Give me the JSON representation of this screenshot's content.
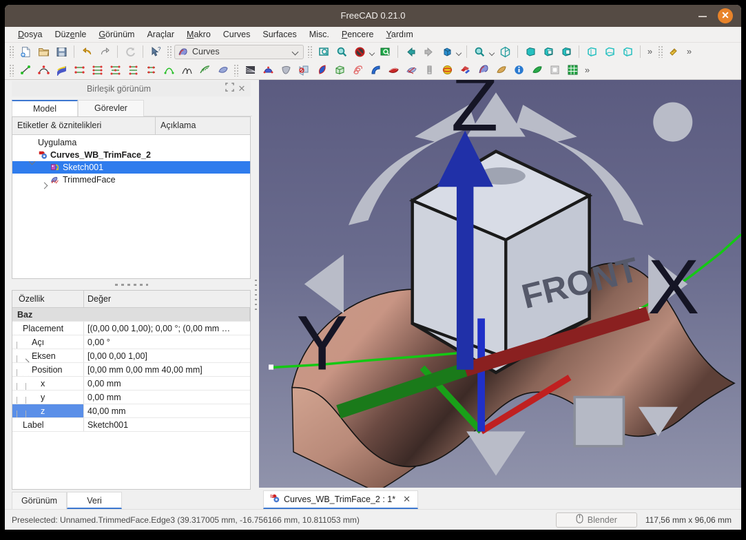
{
  "window": {
    "title": "FreeCAD 0.21.0",
    "minimize_label": "–",
    "close_label": "✕"
  },
  "menubar": {
    "items": [
      {
        "pre": "",
        "mn": "D",
        "post": "osya"
      },
      {
        "pre": "Düz",
        "mn": "e",
        "post": "nle"
      },
      {
        "pre": "",
        "mn": "G",
        "post": "örünüm"
      },
      {
        "pre": "Araçlar",
        "mn": "",
        "post": ""
      },
      {
        "pre": "",
        "mn": "M",
        "post": "akro"
      },
      {
        "pre": "Curves",
        "mn": "",
        "post": ""
      },
      {
        "pre": "Surfaces",
        "mn": "",
        "post": ""
      },
      {
        "pre": "Misc.",
        "mn": "",
        "post": ""
      },
      {
        "pre": "",
        "mn": "P",
        "post": "encere"
      },
      {
        "pre": "",
        "mn": "Y",
        "post": "ardım"
      }
    ]
  },
  "toolbar": {
    "workbench_label": "Curves",
    "overflow_label": "»",
    "row1_icons": [
      "new-document-icon",
      "open-document-icon",
      "save-document-icon",
      "undo-icon",
      "redo-icon",
      "refresh-icon",
      "whats-this-icon"
    ],
    "row1_view_icons": [
      "fit-all-icon",
      "zoom-box-icon",
      "draw-style-icon",
      "fit-selection-icon",
      "back-view-icon",
      "forward-view-icon",
      "axonometric-icon",
      "zoom-icon",
      "isometric-icon",
      "front-view-icon",
      "top-view-icon",
      "right-view-icon",
      "rear-view-icon",
      "bottom-view-icon",
      "left-view-icon",
      "measure-icon"
    ],
    "row2_curve_icons": [
      "line-icon",
      "bspline-icon",
      "editable-spline-icon",
      "join-curve-icon",
      "discretize-icon",
      "approximate-icon",
      "interpolate-icon",
      "parametric-curve-icon",
      "curve-on-surface-icon",
      "blend-curve-icon",
      "comb-plot-icon",
      "zebra-icon"
    ],
    "row2_surface_icon_s": [
      "isocurve-icon",
      "gordon-surface-icon",
      "sweep-surface-icon",
      "trim-face-icon",
      "flatten-face-icon",
      "pipeshell-icon",
      "profile-support-icon",
      "blend-surface-icon",
      "segment-surface-icon",
      "surface-net-icon",
      "hooks-icon",
      "sphere-icon",
      "solid-icon",
      "curves-icon",
      "misc-icon",
      "info-icon",
      "map-icon",
      "extract-icon",
      "grid-icon"
    ]
  },
  "combo_view": {
    "title": "Birleşik görünüm",
    "float_label": "⛶",
    "close_label": "✕",
    "tabs": [
      {
        "label": "Model",
        "active": true
      },
      {
        "label": "Görevler",
        "active": false
      }
    ]
  },
  "tree": {
    "columns": [
      "Etiketler & öznitelikleri",
      "Açıklama"
    ],
    "rows": [
      {
        "label": "Uygulama",
        "depth": 0,
        "arrow": "none",
        "icon": "none",
        "selected": false,
        "bold": false
      },
      {
        "label": "Curves_WB_TrimFace_2",
        "depth": 1,
        "arrow": "down",
        "icon": "document-icon",
        "selected": false,
        "bold": true
      },
      {
        "label": "Sketch001",
        "depth": 2,
        "arrow": "none",
        "icon": "sketch-icon",
        "selected": true,
        "bold": false
      },
      {
        "label": "TrimmedFace",
        "depth": 2,
        "arrow": "right",
        "icon": "trimmed-face-icon",
        "selected": false,
        "bold": false
      }
    ]
  },
  "properties": {
    "columns": [
      "Özellik",
      "Değer"
    ],
    "rows": [
      {
        "kind": "group",
        "key": "Baz",
        "value": ""
      },
      {
        "kind": "item",
        "key": "Placement",
        "value": "[(0,00 0,00 1,00); 0,00 °; (0,00 mm  …",
        "depth": 0,
        "twisty": "down",
        "selected": false
      },
      {
        "kind": "item",
        "key": "Açı",
        "value": "0,00 °",
        "depth": 1,
        "twisty": "none",
        "selected": false
      },
      {
        "kind": "item",
        "key": "Eksen",
        "value": "[0,00 0,00 1,00]",
        "depth": 1,
        "twisty": "right",
        "selected": false
      },
      {
        "kind": "item",
        "key": "Position",
        "value": "[0,00 mm  0,00 mm  40,00 mm]",
        "depth": 1,
        "twisty": "down",
        "selected": false
      },
      {
        "kind": "item",
        "key": "x",
        "value": "0,00 mm",
        "depth": 2,
        "twisty": "none",
        "selected": false
      },
      {
        "kind": "item",
        "key": "y",
        "value": "0,00 mm",
        "depth": 2,
        "twisty": "none",
        "selected": false
      },
      {
        "kind": "item",
        "key": "z",
        "value": "40,00 mm",
        "depth": 2,
        "twisty": "none",
        "selected": true
      },
      {
        "kind": "item",
        "key": "Label",
        "value": "Sketch001",
        "depth": 0,
        "twisty": "none",
        "selected": false
      }
    ]
  },
  "bottom_tabs": [
    {
      "label": "Görünüm",
      "active": false
    },
    {
      "label": "Veri",
      "active": true
    }
  ],
  "document_tab": {
    "label": "Curves_WB_TrimFace_2 : 1*",
    "close_label": "✕",
    "icon": "freecad-document-icon"
  },
  "viewport": {
    "nav_cube_face": "FRONT",
    "axis_labels": {
      "x": "X",
      "y": "Y",
      "z": "Z"
    },
    "colors": {
      "background_top": "#5b5b80",
      "background_bottom": "#9093ab",
      "surface": "#c09080",
      "surface_shadow": "#3b2d2b",
      "curve": "#14c814",
      "control_point": "#ffffff",
      "axis_x": "#b02020",
      "axis_y": "#19a019",
      "axis_z": "#2030c8",
      "nav_cube": "#cfd2dc"
    }
  },
  "statusbar": {
    "message": "Preselected: Unnamed.TrimmedFace.Edge3 (39.317005 mm, -16.756166 mm, 10.811053 mm)",
    "nav_style": "Blender",
    "nav_icon": "mouse-icon",
    "dimensions": "117,56 mm x 96,06 mm"
  }
}
